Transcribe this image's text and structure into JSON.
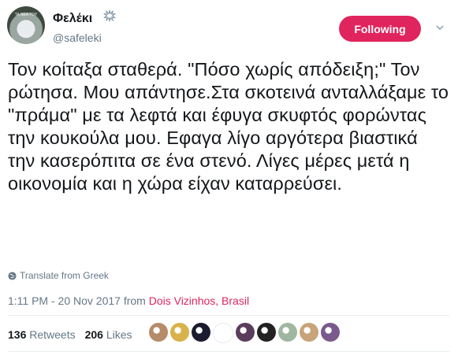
{
  "user": {
    "display_name": "Φελέκι",
    "handle": "@safeleki",
    "avatar_text": "ΤΑ ΝΕΑ ΤΟΥ"
  },
  "follow_button_label": "Following",
  "tweet_text": "Τον κοίταξα σταθερά. \"Πόσο χωρίς απόδειξη;\" Τον ρώτησα. Μου απάντησε.Στα σκοτεινά ανταλλάξαμε το \"πράμα\" με τα λεφτά και έφυγα σκυφτός φορώντας την κουκούλα μου. Εφαγα λίγο αργότερα βιαστικά την κασερόπιτα σε ένα στενό. Λίγες μέρες μετά η οικονομία και η χώρα είχαν καταρρεύσει.",
  "translate_label": "Translate from Greek",
  "timestamp": "1:11 PM - 20 Nov 2017",
  "from_label": "from",
  "location": "Dois Vizinhos, Brasil",
  "stats": {
    "retweets_count": "136",
    "retweets_label": "Retweets",
    "likes_count": "206",
    "likes_label": "Likes"
  },
  "colors": {
    "accent": "#e0245e",
    "muted": "#657786",
    "text": "#14171a"
  },
  "likers": [
    {
      "name": "liker-avatar-1",
      "color": "#b58b6a"
    },
    {
      "name": "liker-avatar-2",
      "color": "#d8b24a"
    },
    {
      "name": "liker-avatar-3",
      "color": "#1b1b2f"
    },
    {
      "name": "liker-avatar-4",
      "color": "#ffffff"
    },
    {
      "name": "liker-avatar-5",
      "color": "#5a3d5c"
    },
    {
      "name": "liker-avatar-6",
      "color": "#222222"
    },
    {
      "name": "liker-avatar-7",
      "color": "#9fb7a1"
    },
    {
      "name": "liker-avatar-8",
      "color": "#c9a37a"
    },
    {
      "name": "liker-avatar-9",
      "color": "#7a5a8c"
    }
  ]
}
